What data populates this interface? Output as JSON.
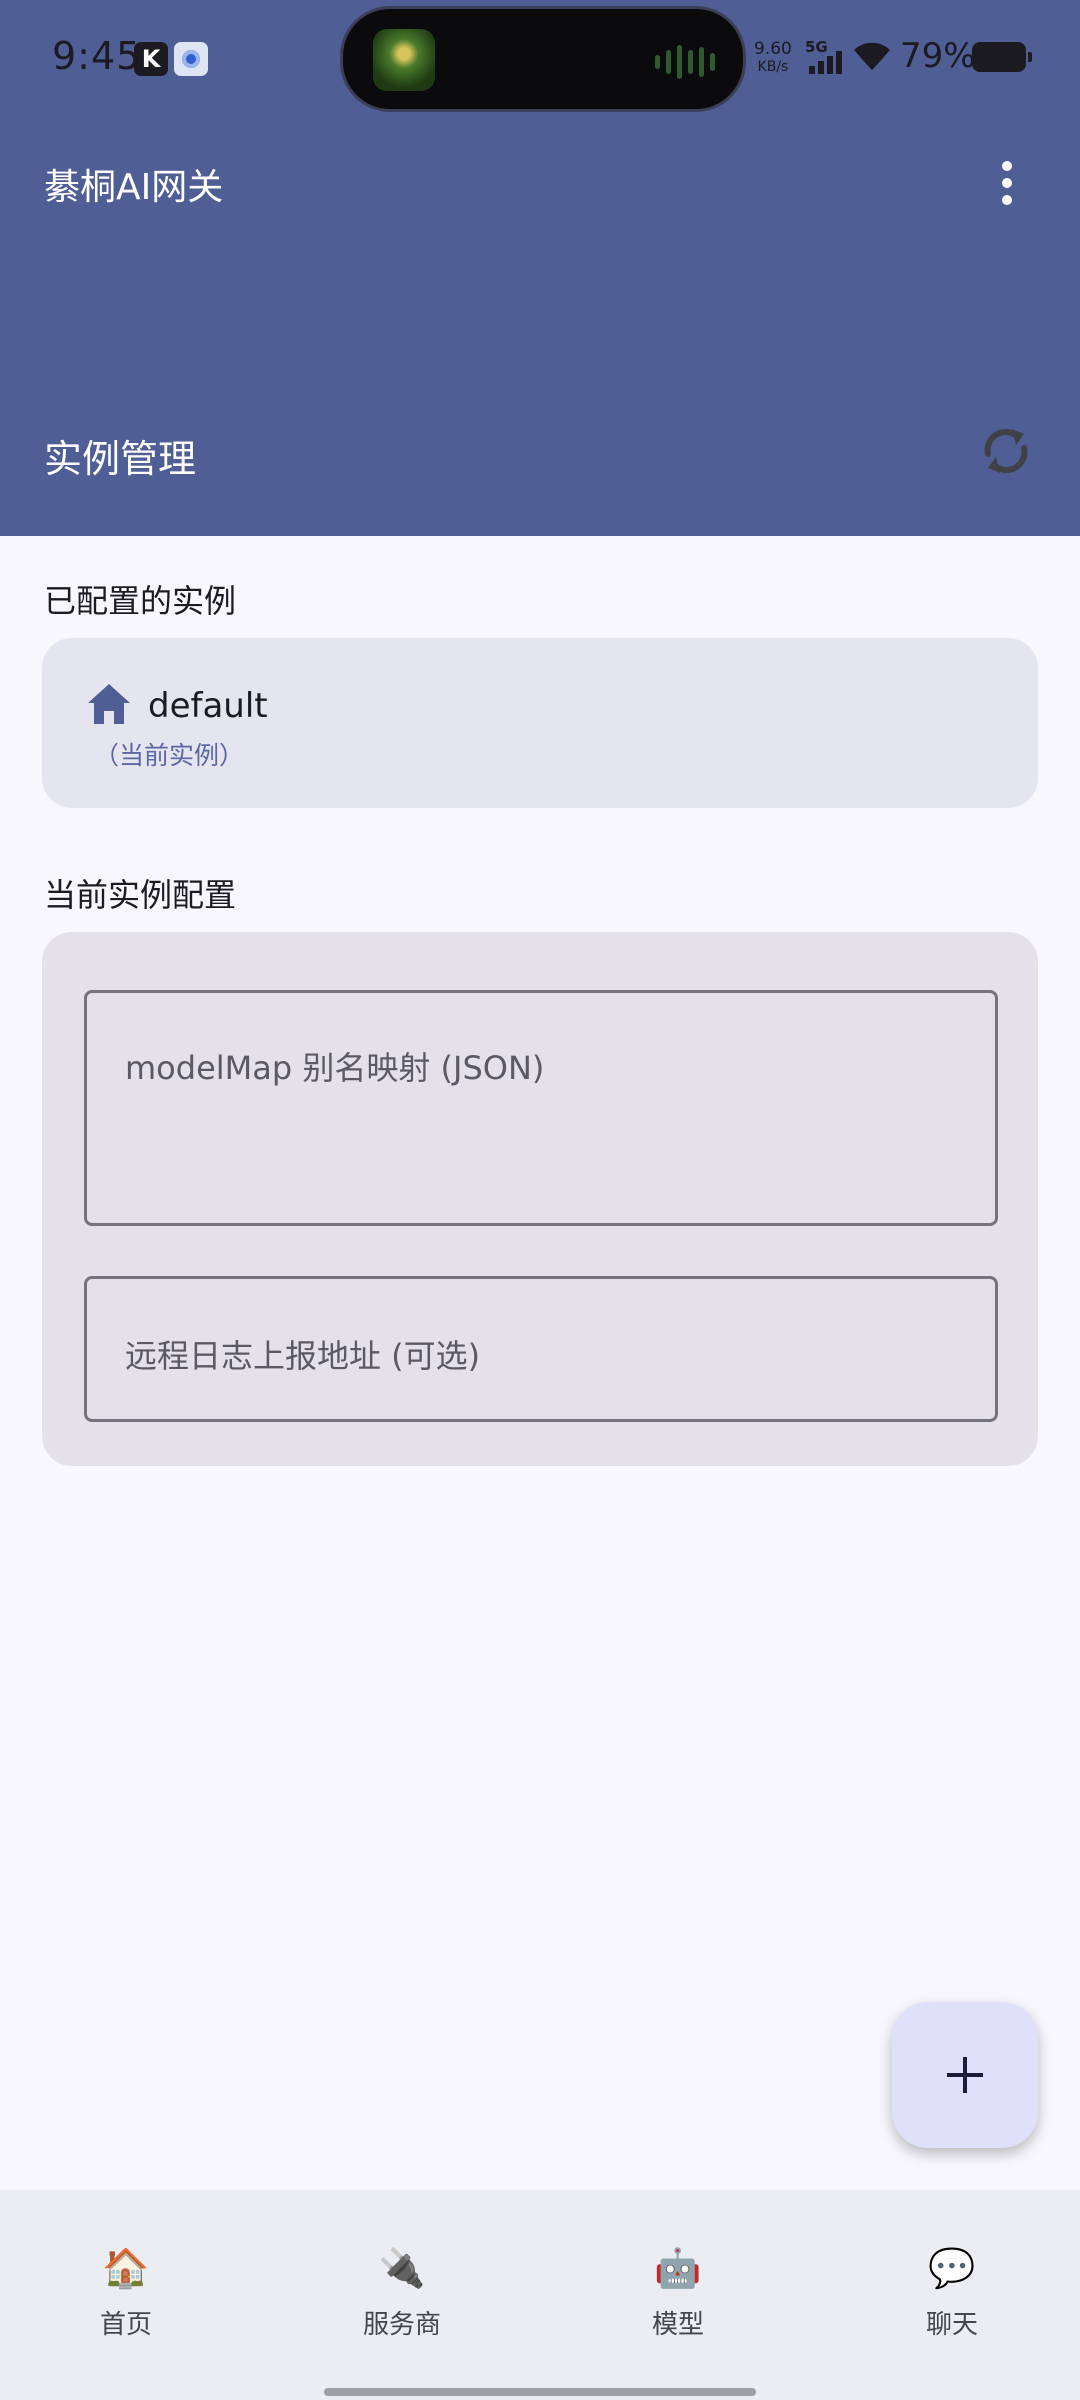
{
  "status_bar": {
    "time": "9:45",
    "k_icon": "K",
    "net_speed_value": "9.60",
    "net_speed_unit": "KB/s",
    "network_type": "5G",
    "battery_percent": "79%",
    "icons": [
      "k-app-icon",
      "camera-app-icon",
      "signal-icon",
      "wifi-icon",
      "battery-icon"
    ]
  },
  "app_bar": {
    "title": "綦桐AI网关",
    "section_title": "实例管理",
    "background_color": "#505e96",
    "icons": [
      "more-vert-icon",
      "refresh-icon"
    ]
  },
  "configured_instances": {
    "heading": "已配置的实例",
    "items": [
      {
        "name": "default",
        "subtitle": "（当前实例）",
        "icon": "home-icon"
      }
    ]
  },
  "current_config": {
    "heading": "当前实例配置",
    "model_map_field": {
      "placeholder": "modelMap 别名映射 (JSON)",
      "value": ""
    },
    "remote_log_field": {
      "placeholder": "远程日志上报地址 (可选)",
      "value": ""
    }
  },
  "fab": {
    "icon": "plus-icon"
  },
  "bottom_nav": {
    "items": [
      {
        "label": "首页",
        "icon": "🏠"
      },
      {
        "label": "服务商",
        "icon": "🔌"
      },
      {
        "label": "模型",
        "icon": "🤖"
      },
      {
        "label": "聊天",
        "icon": "💬"
      }
    ]
  }
}
